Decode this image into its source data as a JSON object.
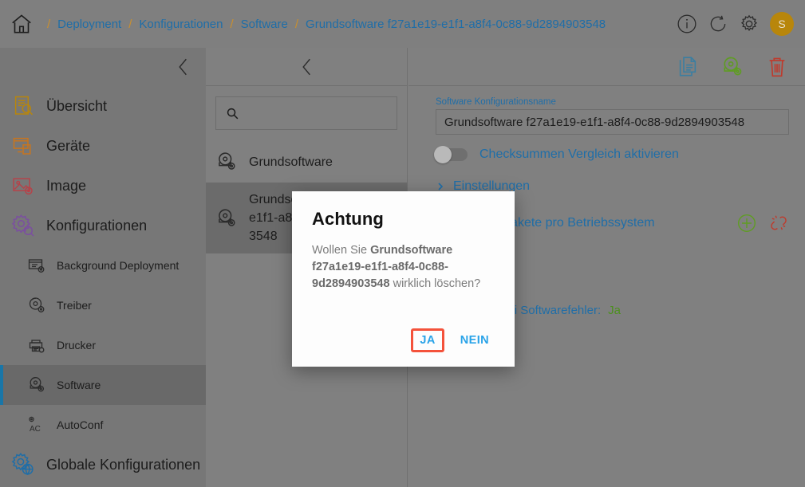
{
  "breadcrumb": {
    "home_icon": "home-icon",
    "separator": "/",
    "items": [
      {
        "label": "Deployment"
      },
      {
        "label": "Konfigurationen"
      },
      {
        "label": "Software"
      },
      {
        "label": "Grundsoftware f27a1e19-e1f1-a8f4-0c88-9d2894903548"
      }
    ]
  },
  "topbar": {
    "info_icon": "info-icon",
    "refresh_icon": "refresh-icon",
    "settings_icon": "gear-icon",
    "avatar_initial": "S",
    "avatar_color": "#b8860b"
  },
  "sidebar": {
    "collapse_icon": "chevron-left-icon",
    "accent_color": "#1976a8",
    "items": [
      {
        "label": "Übersicht",
        "icon": "overview-icon",
        "level": "top",
        "active": false
      },
      {
        "label": "Geräte",
        "icon": "devices-icon",
        "level": "top",
        "active": false
      },
      {
        "label": "Image",
        "icon": "image-icon",
        "level": "top",
        "active": false
      },
      {
        "label": "Konfigurationen",
        "icon": "configurations-icon",
        "level": "top",
        "active": false
      },
      {
        "label": "Background Deployment",
        "icon": "background-deployment-icon",
        "level": "sub",
        "active": false
      },
      {
        "label": "Treiber",
        "icon": "driver-icon",
        "level": "sub",
        "active": false
      },
      {
        "label": "Drucker",
        "icon": "printer-icon",
        "level": "sub",
        "active": false
      },
      {
        "label": "Software",
        "icon": "software-icon",
        "level": "sub",
        "active": true
      },
      {
        "label": "AutoConf",
        "icon": "autoconf-icon",
        "level": "sub",
        "active": false
      },
      {
        "label": "Globale Konfigurationen",
        "icon": "global-configurations-icon",
        "level": "top",
        "active": false
      }
    ]
  },
  "middle_panel": {
    "collapse_icon": "chevron-left-icon",
    "search": {
      "icon": "search-icon",
      "value": "",
      "placeholder": ""
    },
    "items": [
      {
        "label": "Grundsoftware",
        "icon": "software-icon",
        "selected": false
      },
      {
        "label": "Grundsoftware f27a1e19-e1f1-a8f4-0c88-9d2894903548",
        "icon": "software-icon",
        "selected": true
      }
    ]
  },
  "right_panel": {
    "toolbar": [
      {
        "name": "copy-icon",
        "label": "Kopieren",
        "color": "#3b7ea1"
      },
      {
        "name": "software-icon",
        "label": "Software",
        "color": "#5f9c23"
      },
      {
        "name": "trash-icon",
        "label": "Löschen",
        "color": "#c0392b"
      }
    ],
    "name_field": {
      "label": "Software Konfigurationsname",
      "value": "Grundsoftware f27a1e19-e1f1-a8f4-0c88-9d2894903548"
    },
    "checksum_toggle": {
      "label": "Checksummen Vergleich aktivieren",
      "enabled": false
    },
    "expander": {
      "label": "Einstellungen",
      "icon": "chevron-right-icon",
      "expanded": true
    },
    "os_row": {
      "label": "Softwarepakete pro Betriebssystem",
      "add_icon": "plus-circle-icon",
      "unlink_icon": "broken-link-icon",
      "add_color": "#5f9c23",
      "unlink_color": "#c0392b"
    },
    "status": {
      "key": "Abbruch bei Softwarefehler:",
      "value": "Ja",
      "value_color": "#4c8f1e"
    }
  },
  "dialog": {
    "title": "Achtung",
    "text_before": "Wollen Sie ",
    "text_bold": "Grundsoftware f27a1e19-e1f1-a8f4-0c88-9d2894903548",
    "text_after": " wirklich löschen?",
    "confirm_label": "JA",
    "cancel_label": "NEIN",
    "highlight_color": "#f4523b",
    "link_color": "#29a3e8"
  }
}
